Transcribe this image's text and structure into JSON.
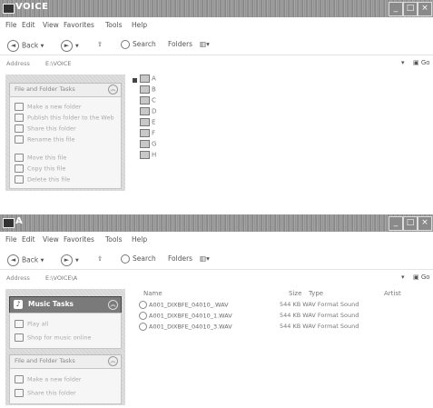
{
  "window1": {
    "title": "VOICE",
    "menu": [
      "File",
      "Edit",
      "View",
      "Favorites",
      "Tools",
      "Help"
    ],
    "toolbar": {
      "back": "Back",
      "search": "Search",
      "folders": "Folders"
    },
    "address": {
      "label": "Address",
      "value": "E:\\VOICE",
      "go": "Go"
    },
    "tasks_header": "File and Folder Tasks",
    "tasks": [
      "Make a new folder",
      "Publish this folder to the Web",
      "Share this folder",
      "Rename this file",
      "Move this file",
      "Copy this file",
      "Delete this file"
    ],
    "folders": [
      "A",
      "B",
      "C",
      "D",
      "E",
      "F",
      "G",
      "H"
    ]
  },
  "window2": {
    "title": "A",
    "menu": [
      "File",
      "Edit",
      "View",
      "Favorites",
      "Tools",
      "Help"
    ],
    "toolbar": {
      "back": "Back",
      "search": "Search",
      "folders": "Folders"
    },
    "address": {
      "label": "Address",
      "value": "E:\\VOICE\\A",
      "go": "Go"
    },
    "music_header": "Music Tasks",
    "music_tasks": [
      "Play all",
      "Shop for music online"
    ],
    "tasks_header": "File and Folder Tasks",
    "tasks": [
      "Make a new folder",
      "Share this folder"
    ],
    "columns": {
      "name": "Name",
      "size": "Size",
      "type": "Type",
      "artist": "Artist"
    },
    "files": [
      {
        "name": "A001_DIXBFE_04010_.WAV",
        "size": "544 KB",
        "type": "WAV Format Sound"
      },
      {
        "name": "A001_DIXBFE_04010_1.WAV",
        "size": "544 KB",
        "type": "WAV Format Sound"
      },
      {
        "name": "A001_DIXBFE_04010_3.WAV",
        "size": "544 KB",
        "type": "WAV Format Sound"
      }
    ]
  }
}
